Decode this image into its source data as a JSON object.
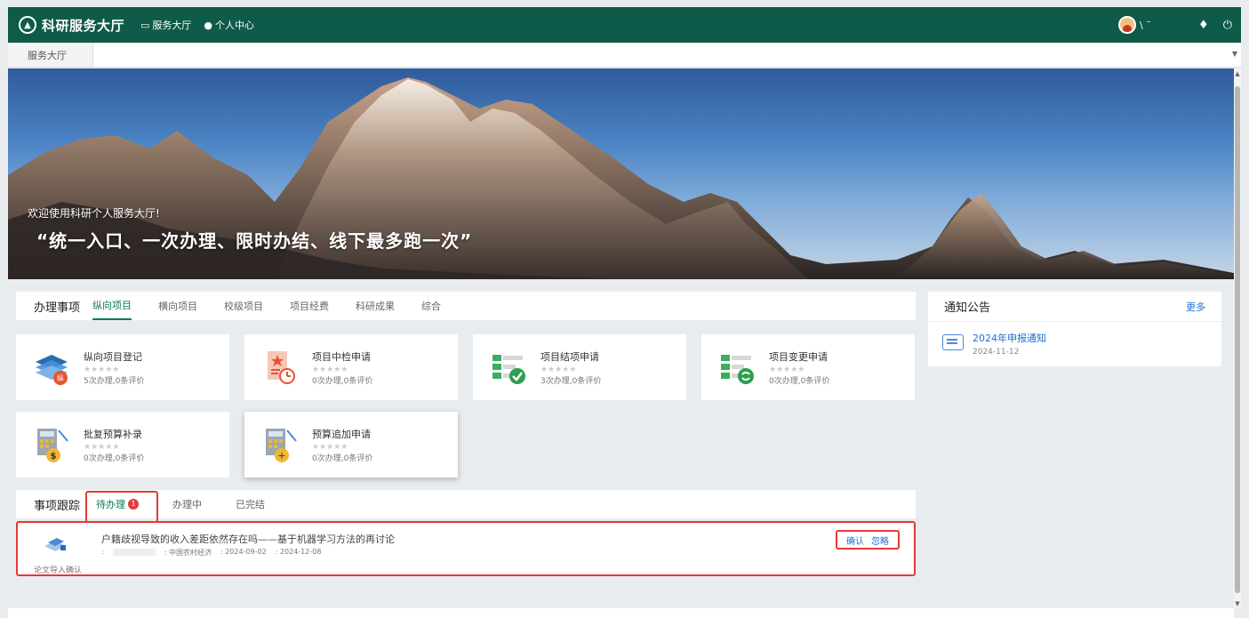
{
  "topbar": {
    "logo_text": "科研服务大厅",
    "nav": [
      {
        "label": "服务大厅",
        "icon": "monitor-icon"
      },
      {
        "label": "个人中心",
        "icon": "user-icon"
      }
    ],
    "user_name": "\\ ˉ"
  },
  "tabstrip": {
    "home_tab": "服务大厅"
  },
  "banner": {
    "welcome": "欢迎使用科研个人服务大厅!",
    "slogan": "“统一入口、一次办理、限时办结、线下最多跑一次”"
  },
  "services": {
    "title": "办理事项",
    "tabs": [
      "纵向项目",
      "横向项目",
      "校级项目",
      "项目经费",
      "科研成果",
      "综合"
    ],
    "active_tab": 0,
    "cards": [
      {
        "name": "纵向项目登记",
        "stars": "★★★★★",
        "stats": "5次办理,0条评价",
        "icon": "stack-register-icon"
      },
      {
        "name": "项目中检申请",
        "stars": "★★★★★",
        "stats": "0次办理,0条评价",
        "icon": "document-clock-icon"
      },
      {
        "name": "项目结项申请",
        "stars": "★★★★★",
        "stats": "3次办理,0条评价",
        "icon": "list-check-icon"
      },
      {
        "name": "项目变更申请",
        "stars": "★★★★★",
        "stats": "0次办理,0条评价",
        "icon": "list-refresh-icon"
      },
      {
        "name": "批复预算补录",
        "stars": "★★★★★",
        "stats": "0次办理,0条评价",
        "icon": "calculator-dollar-icon"
      },
      {
        "name": "预算追加申请",
        "stars": "★★★★★",
        "stats": "0次办理,0条评价",
        "icon": "calculator-plus-icon"
      }
    ]
  },
  "notice": {
    "title": "通知公告",
    "more": "更多",
    "items": [
      {
        "title": "2024年申报通知",
        "date": "2024-11-12"
      }
    ]
  },
  "tracking": {
    "title": "事项跟踪",
    "tabs": [
      {
        "label": "待办理",
        "badge": "1"
      },
      {
        "label": "办理中"
      },
      {
        "label": "已完结"
      }
    ],
    "items": [
      {
        "type": "论文导入确认",
        "title": "户籍歧视导致的收入差距依然存在吗——基于机器学习方法的再讨论",
        "author_label": ":",
        "journal": ": 中国农村经济",
        "date1": ": 2024-09-02",
        "date2": ": 2024-12-08",
        "actions": [
          "确认",
          "忽略"
        ]
      }
    ]
  },
  "colors": {
    "topbar": "#0e5b49",
    "accent": "#0e7a4f",
    "link": "#1e6fd0",
    "highlight_border": "#e53935"
  }
}
